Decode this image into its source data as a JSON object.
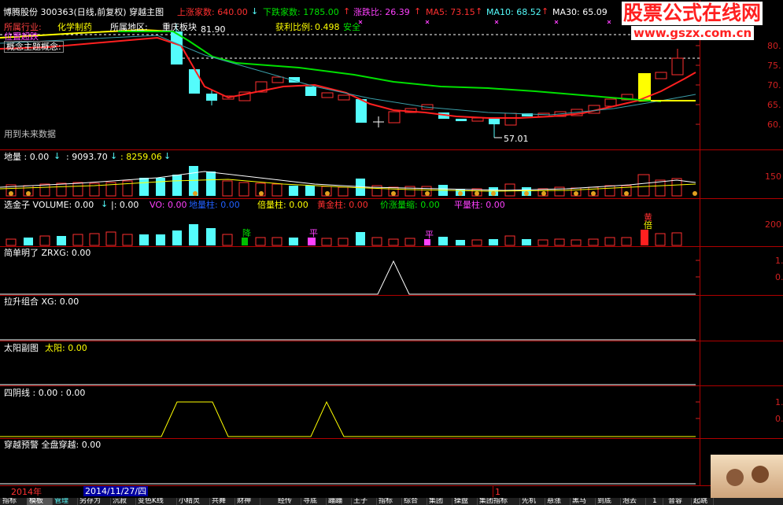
{
  "watermark": {
    "title": "股票公式在线网",
    "url": "www.gszx.com.cn"
  },
  "header": {
    "stock": "博腾股份  300363(日线,前复权) 穿越主图",
    "up_label": "上涨家数: 640.00",
    "down_label": "下跌家数: 1785.00",
    "ratio_label": "涨跌比: 26.39",
    "ma5": "MA5: 73.15",
    "ma10": "MA10: 68.52",
    "ma30": "MA30: 65.09"
  },
  "info": {
    "industry_prefix": "所属行业:",
    "industry": "化学制药",
    "region_prefix": "所属地区:",
    "region": "重庆板块",
    "region_price": "81.90",
    "profit_prefix": "获利比例:",
    "profit": "0.498",
    "safety": "安全",
    "concept_top": "位置超跌",
    "concept": "概念主题概念:"
  },
  "main_chart": {
    "future_data": "用到未来数据",
    "low_label": "57.01",
    "y_ticks": [
      "80.",
      "75.",
      "70.",
      "65.",
      "60."
    ]
  },
  "panel2": {
    "title": "地量 : 0.00",
    "v2": ": 9093.70",
    "v3": ": 8259.06",
    "y_tick": "150"
  },
  "panel3": {
    "title": "选金子 VOLUME: 0.00",
    "bar": "|: 0.00",
    "vo": "VO: 0.00",
    "dl": "地量柱: 0.00",
    "bl": "倍量柱: 0.00",
    "hj": "黄金柱: 0.00",
    "jz": "价涨量缩: 0.00",
    "pl": "平量柱: 0.00",
    "marks": [
      "降",
      "平",
      "平",
      "黄",
      "倍"
    ],
    "y_tick": "200"
  },
  "panel4": {
    "title": "简单明了 ZRXG: 0.00",
    "y_ticks": [
      "1.",
      "0."
    ]
  },
  "panel5": {
    "title": "拉升组合 XG: 0.00"
  },
  "panel6": {
    "title": "太阳副图",
    "value": "太阳: 0.00"
  },
  "panel7": {
    "title": "四阴线 : 0.00 : 0.00",
    "y_ticks": [
      "1.",
      "0."
    ]
  },
  "panel8": {
    "title": "穿越预警 全盘穿越: 0.00"
  },
  "footer": {
    "year": "2014年",
    "date": "2014/11/27/四",
    "marker": "1",
    "tabs": [
      "指标",
      "模板",
      "管理",
      "另存为",
      "沉寂",
      "变色K线",
      "小精灵",
      "共舞",
      "财神",
      "",
      "经传",
      "寻底",
      "蹦蹦",
      "王子",
      "指标",
      "综合",
      "集团",
      "操盘",
      "集团指标",
      "先机",
      "悬涨",
      "黑马",
      "到底",
      "泡去",
      "1",
      "音容",
      "起跳"
    ]
  },
  "colors": {
    "up": "#ff3030",
    "down": "#54fcfc",
    "ma_yellow": "#ffff00",
    "ma_green": "#00e000",
    "ma_red": "#ff2020",
    "grid": "#b00000"
  }
}
